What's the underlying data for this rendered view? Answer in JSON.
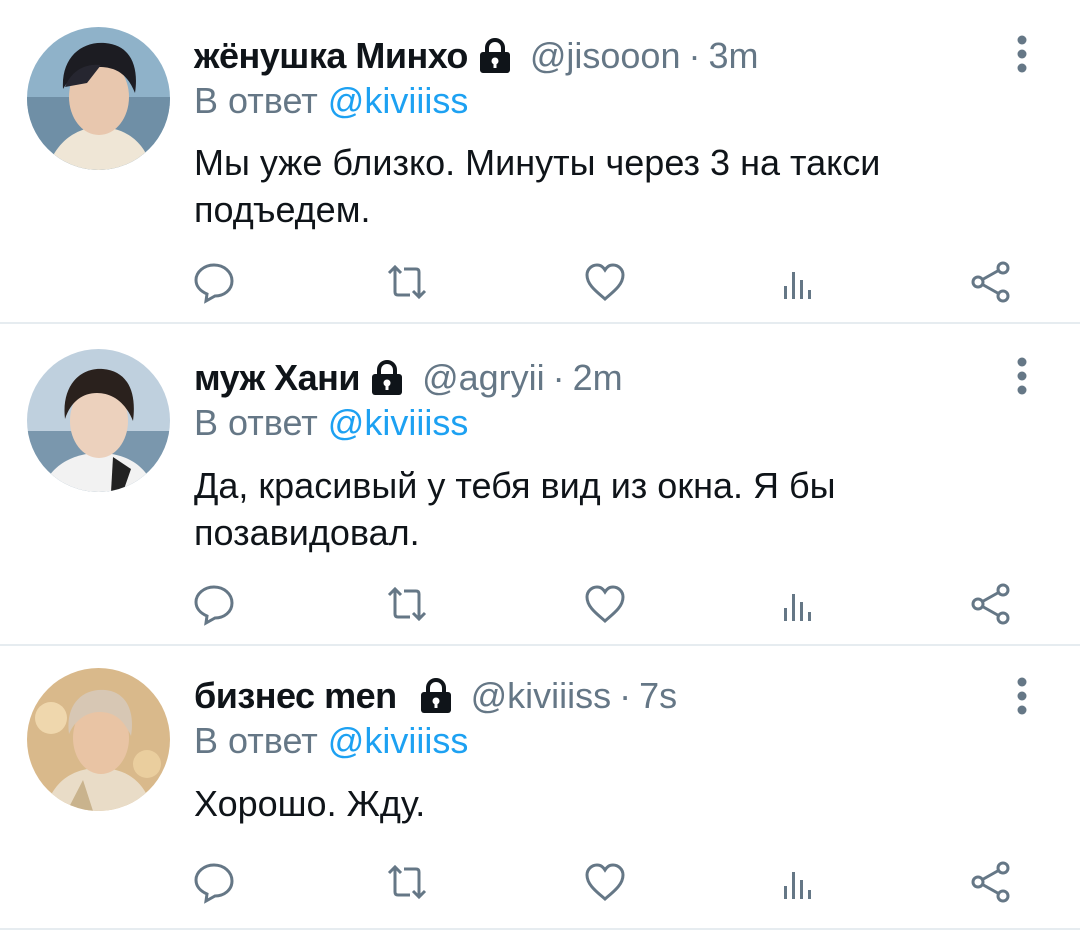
{
  "tweets": [
    {
      "name": "жёнушка Минхо",
      "handle": "@jisooon",
      "time": "3m",
      "reply_prefix": "В ответ",
      "reply_to": "@kiviiiss",
      "text": "Мы уже близко. Минуты через 3 на такси подъедем."
    },
    {
      "name": "муж Хани",
      "handle": "@agryii",
      "time": "2m",
      "reply_prefix": "В ответ",
      "reply_to": "@kiviiiss",
      "text": "Да, красивый у тебя вид из окна. Я бы позавидовал."
    },
    {
      "name": "бизнес men",
      "handle": "@kiviiiss",
      "time": "7s",
      "reply_prefix": "В ответ",
      "reply_to": "@kiviiiss",
      "text": "Хорошо. Жду."
    }
  ],
  "separator": "·",
  "icons": {
    "lock": "lock-icon",
    "more": "more-vertical-icon",
    "reply": "reply-bubble-icon",
    "retweet": "retweet-icon",
    "like": "heart-icon",
    "stats": "analytics-bars-icon",
    "share": "share-icon"
  },
  "colors": {
    "text": "#0f1419",
    "secondary": "#657786",
    "link": "#1da1f2",
    "divider": "#e6ecf0",
    "icon": "#657786"
  }
}
